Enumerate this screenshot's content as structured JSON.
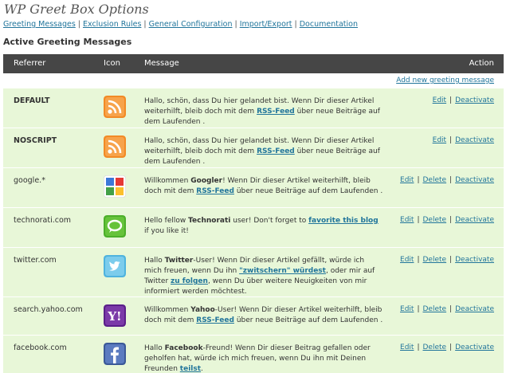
{
  "page": {
    "title": "WP Greet Box Options"
  },
  "subnav": {
    "items": [
      "Greeting Messages",
      "Exclusion Rules",
      "General Configuration",
      "Import/Export",
      "Documentation"
    ],
    "separator": "|"
  },
  "section_title": "Active Greeting Messages",
  "table": {
    "headers": {
      "referrer": "Referrer",
      "icon": "Icon",
      "message": "Message",
      "action": "Action"
    },
    "add_link": "Add new greeting message",
    "action_labels": {
      "edit": "Edit",
      "delete": "Delete",
      "deactivate": "Deactivate",
      "separator": "|"
    }
  },
  "rows": [
    {
      "referrer": "DEFAULT",
      "icon": "rss-icon",
      "msg": [
        "Hallo, schön, dass Du hier gelandet bist. Wenn Dir dieser Artikel weiterhilft, bleib doch mit dem ",
        "RSS-Feed",
        " über neue Beiträge auf dem Laufenden ."
      ]
    },
    {
      "referrer": "NOSCRIPT",
      "icon": "rss-icon",
      "msg": [
        "Hallo, schön, dass Du hier gelandet bist. Wenn Dir dieser Artikel weiterhilft, bleib doch mit dem ",
        "RSS-Feed",
        " über neue Beiträge auf dem Laufenden ."
      ]
    },
    {
      "referrer": "google.*",
      "icon": "google-icon",
      "msg": [
        "Willkommen ",
        "Googler",
        "! Wenn Dir dieser Artikel weiterhilft, bleib doch mit dem ",
        "RSS-Feed",
        " über neue Beiträge auf dem Laufenden ."
      ]
    },
    {
      "referrer": "technorati.com",
      "icon": "technorati-icon",
      "msg": [
        "Hello fellow ",
        "Technorati",
        " user! Don't forget to ",
        "favorite this blog",
        " if you like it!"
      ]
    },
    {
      "referrer": "twitter.com",
      "icon": "twitter-icon",
      "msg": [
        "Hallo ",
        "Twitter",
        "-User! Wenn Dir dieser Artikel gefällt, würde ich mich freuen, wenn Du ihn ",
        "\"zwitschern\" würdest",
        ", oder mir auf Twitter ",
        "zu folgen",
        ", wenn Du über weitere Neuigkeiten von mir informiert werden möchtest."
      ]
    },
    {
      "referrer": "search.yahoo.com",
      "icon": "yahoo-icon",
      "msg": [
        "Willkommen ",
        "Yahoo",
        "-User! Wenn Dir dieser Artikel weiterhilft, bleib doch mit dem ",
        "RSS-Feed",
        " über neue Beiträge auf dem Laufenden ."
      ]
    },
    {
      "referrer": "facebook.com",
      "icon": "facebook-icon",
      "msg": [
        "Hallo ",
        "Facebook",
        "-Freund! Wenn Dir dieser Beitrag gefallen oder geholfen hat, würde ich mich freuen, wenn Du ihn mit Deinen Freunden ",
        "teilst",
        "."
      ]
    }
  ],
  "colors": {
    "row_bg": "#e8f7d8",
    "header_bg": "#464646",
    "link": "#21759b"
  }
}
